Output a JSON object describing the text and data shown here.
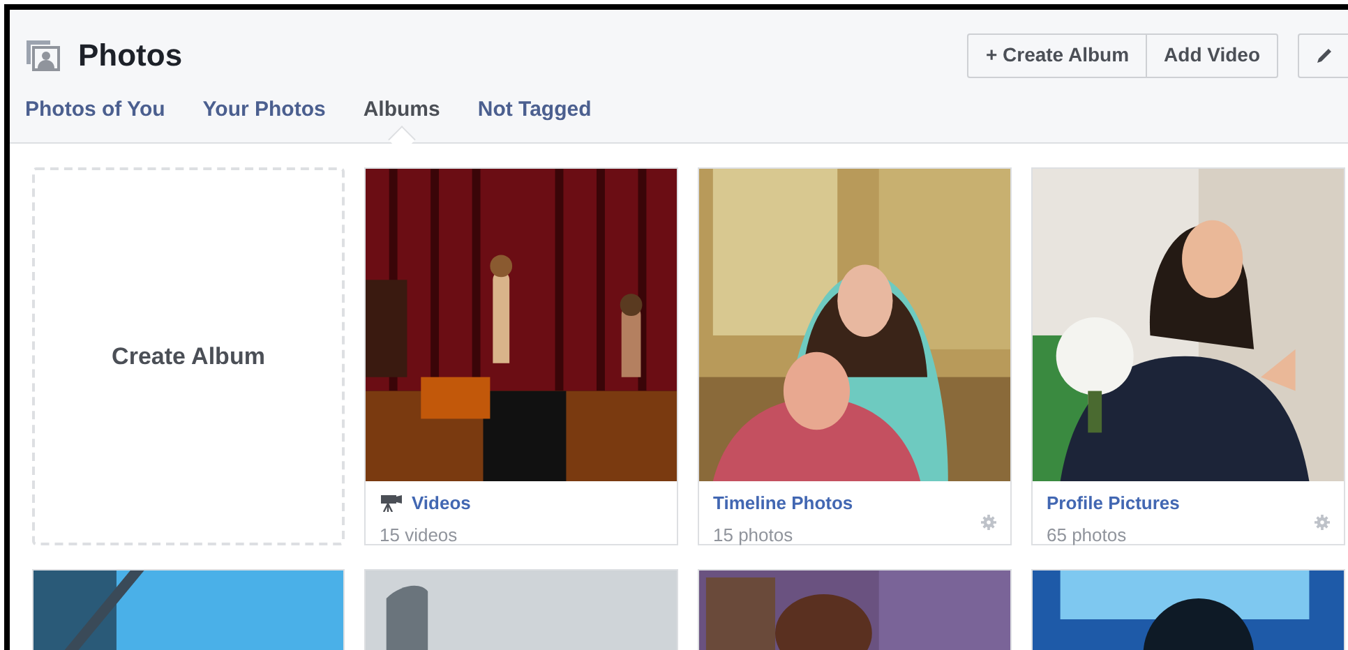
{
  "header": {
    "title": "Photos",
    "actions": [
      {
        "label": "+ Create Album"
      },
      {
        "label": "Add Video"
      }
    ]
  },
  "tabs": [
    {
      "label": "Photos of You",
      "selected": false
    },
    {
      "label": "Your Photos",
      "selected": false
    },
    {
      "label": "Albums",
      "selected": true
    },
    {
      "label": "Not Tagged",
      "selected": false
    }
  ],
  "albums": [
    {
      "kind": "create",
      "label": "Create Album"
    },
    {
      "kind": "video_album",
      "name": "Videos",
      "count": "15 videos"
    },
    {
      "kind": "photo_album",
      "name": "Timeline Photos",
      "count": "15 photos"
    },
    {
      "kind": "photo_album",
      "name": "Profile Pictures",
      "count": "65 photos"
    },
    {
      "kind": "picture"
    },
    {
      "kind": "picture"
    },
    {
      "kind": "picture"
    },
    {
      "kind": "picture"
    }
  ]
}
